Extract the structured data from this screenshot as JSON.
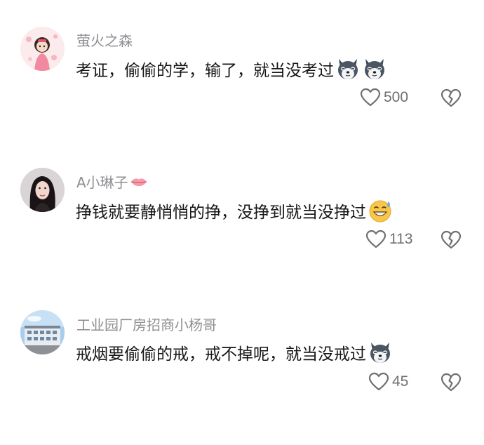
{
  "comments": [
    {
      "username": "萤火之森",
      "text": "考证，偷偷的学，输了，就当没考过",
      "emojis": [
        "husky-dog-emoji",
        "husky-dog-emoji"
      ],
      "likes": "500",
      "avatar": "cartoon-girl-avatar"
    },
    {
      "username": "A小琳子",
      "username_emoji": "lips-emoji",
      "text": "挣钱就要静悄悄的挣，没挣到就当没挣过",
      "emojis": [
        "grinning-sweat-emoji"
      ],
      "likes": "113",
      "avatar": "woman-photo-avatar"
    },
    {
      "username": "工业园厂房招商小杨哥",
      "text": "戒烟要偷偷的戒，戒不掉呢，就当没戒过",
      "emojis": [
        "husky-dog-emoji"
      ],
      "likes": "45",
      "avatar": "factory-building-avatar"
    }
  ],
  "icons": {
    "like": "heart-outline-icon",
    "dislike": "broken-heart-icon"
  },
  "colors": {
    "username": "#8e8e93",
    "text": "#161616",
    "count": "#6f6f74"
  }
}
